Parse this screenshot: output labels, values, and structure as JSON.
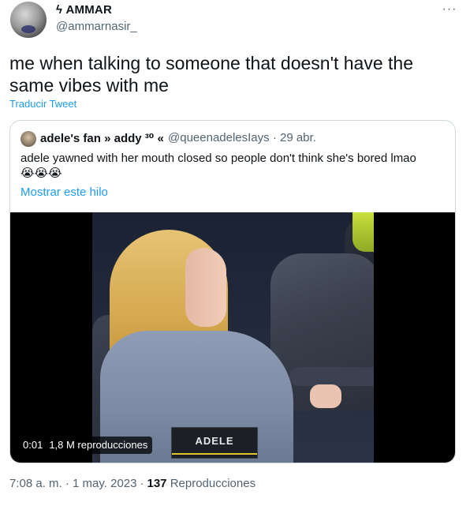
{
  "author": {
    "name": "ϟ AMMAR",
    "handle": "@ammarnasir_"
  },
  "more_label": "···",
  "tweet_text": "me when talking to someone that doesn't have the same vibes with me",
  "translate_label": "Traducir Tweet",
  "quote": {
    "name": "adele's fan » addy ³⁰ «",
    "handle": "@queenadelesIays · 29 abr.",
    "text": "adele yawned with her mouth closed so people don't think she's bored lmao",
    "emojis": "😭😭😭",
    "show_thread": "Mostrar este hilo",
    "video": {
      "time": "0:01",
      "views": "1,8 M reproducciones",
      "caption_tag": "ADELE"
    }
  },
  "footer": {
    "timestamp": "7:08 a. m. · 1 may. 2023",
    "separator": "·",
    "views_count": "137",
    "views_label": "Reproducciones"
  },
  "colors": {
    "link": "#1d9bf0",
    "muted": "#536471",
    "text": "#0f1419",
    "border": "#cfd9de"
  }
}
